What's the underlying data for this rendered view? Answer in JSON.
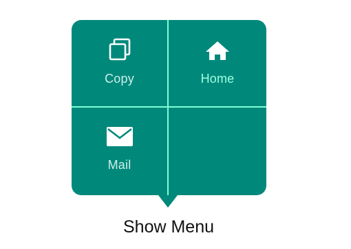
{
  "menu": {
    "items": [
      {
        "label": "Copy",
        "icon": "copy-icon"
      },
      {
        "label": "Home",
        "icon": "home-icon"
      },
      {
        "label": "Mail",
        "icon": "mail-icon"
      }
    ],
    "colors": {
      "background": "#00897b",
      "divider": "#7fffd4",
      "icon": "#ffffff",
      "label": "#cdeee9",
      "active_label": "#9effe0"
    }
  },
  "trigger": {
    "label": "Show Menu"
  }
}
